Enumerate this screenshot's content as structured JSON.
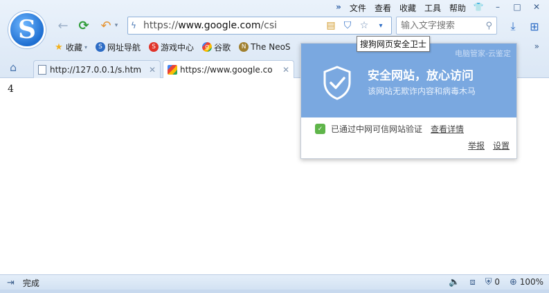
{
  "menu": {
    "chevron": "»",
    "items": [
      "文件",
      "查看",
      "收藏",
      "工具",
      "帮助"
    ]
  },
  "window_buttons": {
    "skin": "👕",
    "minimize": "–",
    "maximize": "□",
    "close": "✕"
  },
  "logo": {
    "letter": "S"
  },
  "nav": {
    "back": "←",
    "refresh": "⟳",
    "undo": "↶",
    "undo_caret": "▾"
  },
  "address": {
    "url_prefix": "https://",
    "url_domain": "www.google.com",
    "url_path": "/csi",
    "bolt_icon": "ϟ",
    "shield_icon": "⛉",
    "star_icon": "☆",
    "caret_icon": "▾",
    "note_icon": "▤"
  },
  "search": {
    "placeholder": "输入文字搜索",
    "icon": "⚲"
  },
  "toolbar_right": {
    "download_icon": "⤓",
    "apps_icon": "⊞"
  },
  "bookmarks": {
    "items": [
      {
        "label": "收藏",
        "icon": "★"
      },
      {
        "label": "网址导航",
        "icon": "S"
      },
      {
        "label": "游戏中心",
        "icon": "S"
      },
      {
        "label": "谷歌",
        "icon": "g"
      },
      {
        "label": "The NeoS",
        "icon": "N"
      }
    ],
    "favorites_caret": "▾",
    "more": "»"
  },
  "tabs": {
    "home_icon": "⌂",
    "items": [
      {
        "label": "http://127.0.0.1/s.htm",
        "close": "✕"
      },
      {
        "label": "https://www.google.co",
        "close": "✕"
      }
    ]
  },
  "content": {
    "value": "4"
  },
  "tooltip": {
    "text": "搜狗网页安全卫士"
  },
  "security_panel": {
    "provider": "电脑管家-云鉴定",
    "title": "安全网站，放心访问",
    "subtitle": "该网站无欺诈内容和病毒木马",
    "verified_text": "已通过中网可信网站验证",
    "detail_link": "查看详情",
    "actions": [
      "举报",
      "设置"
    ],
    "accent": "#7aa8e0"
  },
  "statusbar": {
    "toggle_icon": "⇥",
    "status": "完成",
    "sound_icon": "🔈",
    "tools_icon": "⧈",
    "adblock_icon": "⛨",
    "adblock_count": "0",
    "zoom_icon": "⊕",
    "zoom": "100%"
  }
}
